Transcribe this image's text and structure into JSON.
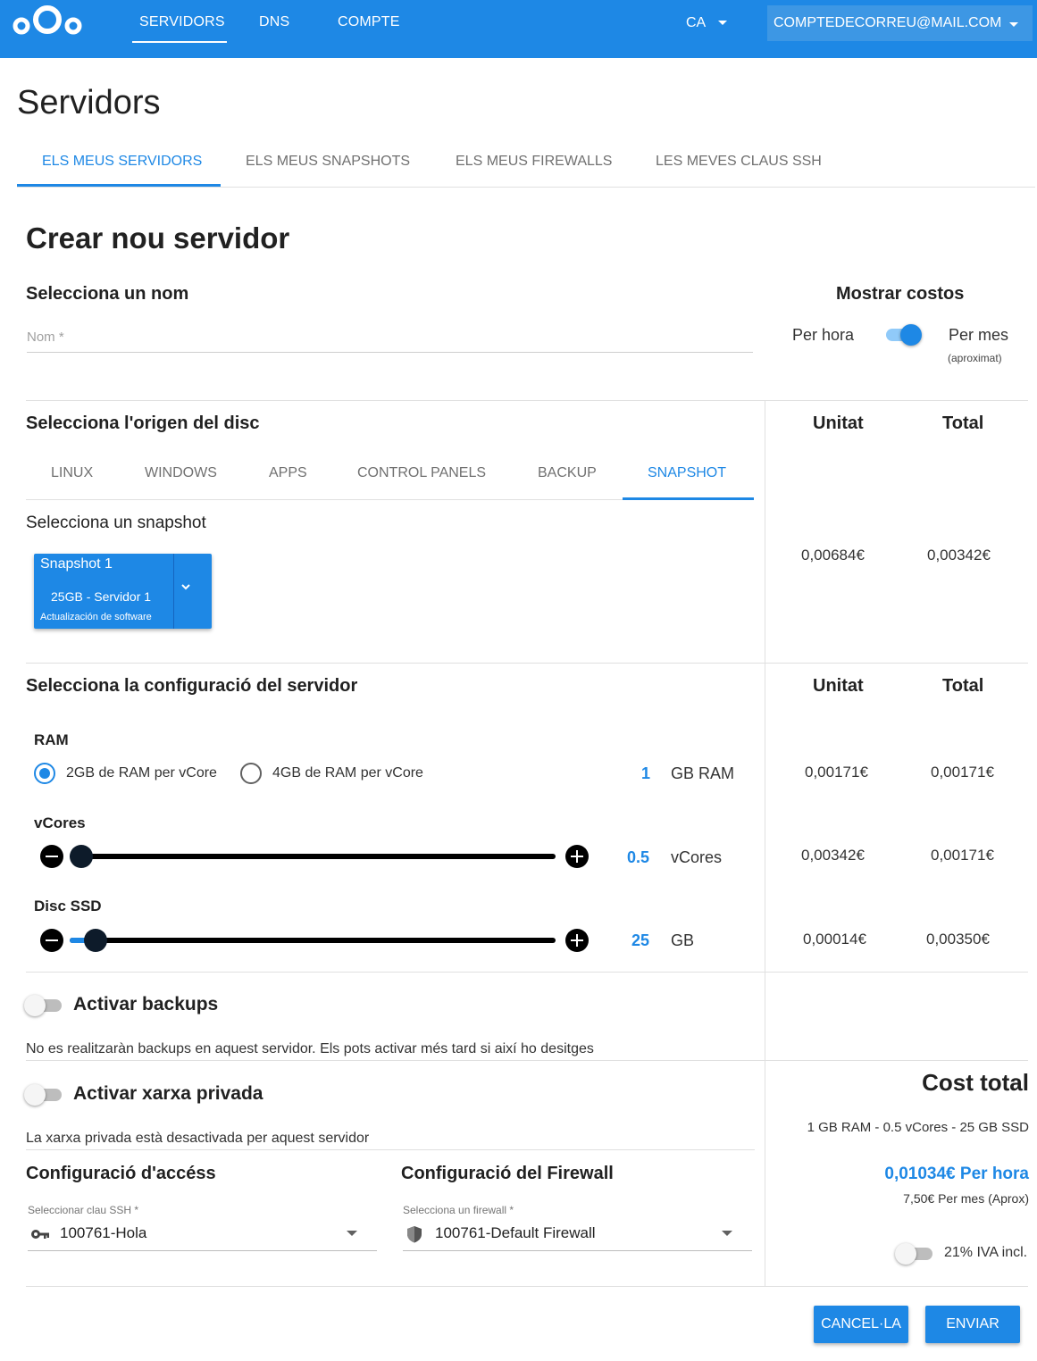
{
  "topbar": {
    "nav": [
      "SERVIDORS",
      "DNS",
      "COMPTE"
    ],
    "language": "CA",
    "account": "COMPTEDECORREU@MAIL.COM"
  },
  "page_title": "Servidors",
  "tabs": [
    "ELS MEUS SERVIDORS",
    "ELS MEUS SNAPSHOTS",
    "ELS MEUS FIREWALLS",
    "LES MEVES CLAUS SSH"
  ],
  "form": {
    "title": "Crear nou servidor",
    "name_section": "Selecciona un nom",
    "name_placeholder": "Nom *",
    "name_value": ""
  },
  "costs_toggle": {
    "title": "Mostrar costos",
    "left": "Per hora",
    "right": "Per mes",
    "note": "(aproximat)",
    "state": "per_month"
  },
  "disk": {
    "title": "Selecciona l'origen del disc",
    "tabs": [
      "LINUX",
      "WINDOWS",
      "APPS",
      "CONTROL PANELS",
      "BACKUP",
      "SNAPSHOT"
    ],
    "active_tab": "SNAPSHOT",
    "snapshot_label": "Selecciona un snapshot",
    "snapshot": {
      "name": "Snapshot 1",
      "detail": "25GB - Servidor 1",
      "note": "Actualización de software"
    },
    "unit_head": "Unitat",
    "total_head": "Total",
    "unit_price": "0,00684€",
    "total_price": "0,00342€"
  },
  "config": {
    "title": "Selecciona la configuració del servidor",
    "unit_head": "Unitat",
    "total_head": "Total",
    "ram": {
      "label": "RAM",
      "option1": "2GB de RAM per vCore",
      "option2": "4GB de RAM per vCore",
      "selected": "option1",
      "value": "1",
      "unit": "GB RAM",
      "unit_price": "0,00171€",
      "total_price": "0,00171€"
    },
    "vcores": {
      "label": "vCores",
      "value": "0.5",
      "unit": "vCores",
      "slider_fraction": 0.0,
      "unit_price": "0,00342€",
      "total_price": "0,00171€"
    },
    "disk": {
      "label": "Disc SSD",
      "value": "25",
      "unit": "GB",
      "slider_fraction": 0.03,
      "unit_price": "0,00014€",
      "total_price": "0,00350€"
    }
  },
  "backups": {
    "title": "Activar backups",
    "enabled": false,
    "desc": "No es realitzaràn backups en aquest servidor. Els pots activar més tard si així ho desitges"
  },
  "private_network": {
    "title": "Activar xarxa privada",
    "enabled": false,
    "desc": "La xarxa privada està desactivada per aquest servidor"
  },
  "access": {
    "title": "Configuració d'accéss",
    "label": "Seleccionar clau SSH *",
    "value": "100761-Hola"
  },
  "firewall": {
    "title": "Configuració del Firewall",
    "label": "Selecciona un firewall *",
    "value": "100761-Default Firewall"
  },
  "total": {
    "title": "Cost total",
    "summary": "1 GB RAM - 0.5 vCores - 25 GB SSD",
    "per_hour": "0,01034€ Per hora",
    "per_month": "7,50€ Per mes (Aprox)",
    "iva_label": "21% IVA incl.",
    "iva_enabled": false
  },
  "buttons": {
    "cancel": "CANCEL·LA",
    "submit": "ENVIAR"
  },
  "colors": {
    "primary": "#1e88e5",
    "topbar": "#1e88e5",
    "account_bg": "#3d97e4"
  }
}
